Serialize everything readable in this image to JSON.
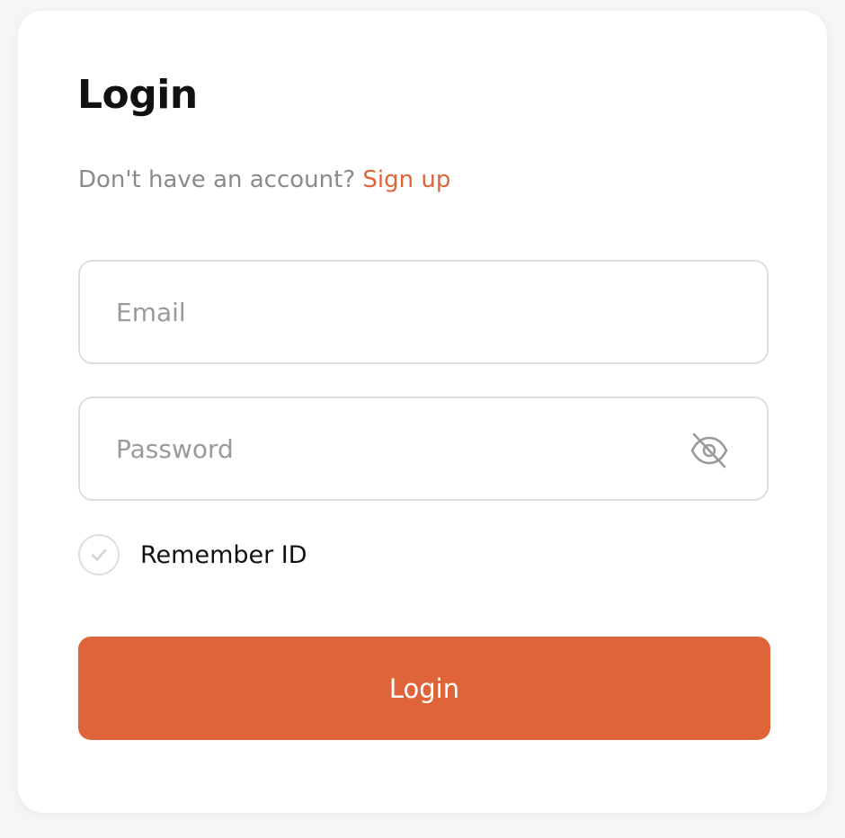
{
  "form": {
    "title": "Login",
    "prompt_text": "Don't have an account?",
    "signup_link": "Sign up",
    "email": {
      "placeholder": "Email",
      "value": ""
    },
    "password": {
      "placeholder": "Password",
      "value": "",
      "toggle_icon": "eye-off-icon"
    },
    "remember": {
      "label": "Remember ID",
      "checked": false,
      "icon": "check-icon"
    },
    "submit_label": "Login"
  },
  "colors": {
    "accent": "#e0643a",
    "title": "#111111",
    "muted_text": "#8a8a8a",
    "placeholder": "#9a9a9a",
    "border": "#dedede",
    "card_background": "#ffffff",
    "page_background": "#f6f6f6"
  }
}
